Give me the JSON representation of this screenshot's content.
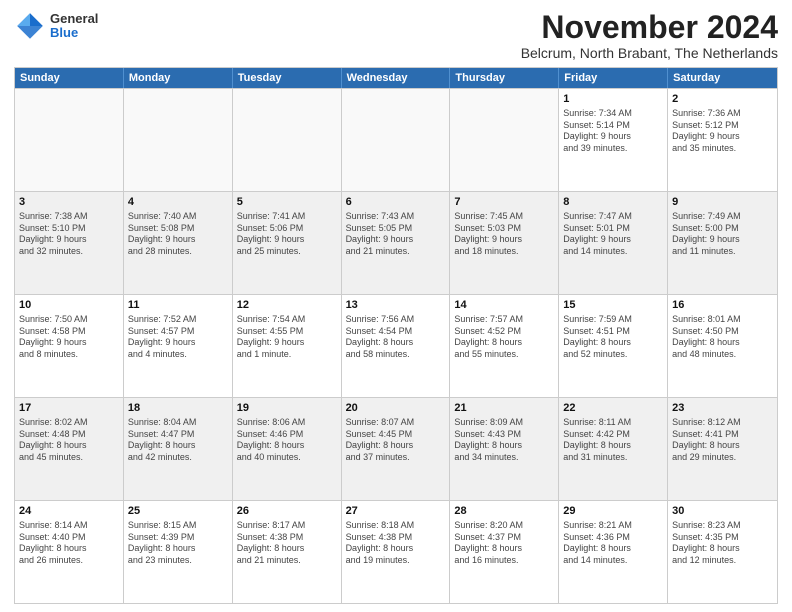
{
  "logo": {
    "general": "General",
    "blue": "Blue"
  },
  "title": "November 2024",
  "location": "Belcrum, North Brabant, The Netherlands",
  "days_of_week": [
    "Sunday",
    "Monday",
    "Tuesday",
    "Wednesday",
    "Thursday",
    "Friday",
    "Saturday"
  ],
  "weeks": [
    [
      {
        "day": "",
        "info": ""
      },
      {
        "day": "",
        "info": ""
      },
      {
        "day": "",
        "info": ""
      },
      {
        "day": "",
        "info": ""
      },
      {
        "day": "",
        "info": ""
      },
      {
        "day": "1",
        "info": "Sunrise: 7:34 AM\nSunset: 5:14 PM\nDaylight: 9 hours\nand 39 minutes."
      },
      {
        "day": "2",
        "info": "Sunrise: 7:36 AM\nSunset: 5:12 PM\nDaylight: 9 hours\nand 35 minutes."
      }
    ],
    [
      {
        "day": "3",
        "info": "Sunrise: 7:38 AM\nSunset: 5:10 PM\nDaylight: 9 hours\nand 32 minutes."
      },
      {
        "day": "4",
        "info": "Sunrise: 7:40 AM\nSunset: 5:08 PM\nDaylight: 9 hours\nand 28 minutes."
      },
      {
        "day": "5",
        "info": "Sunrise: 7:41 AM\nSunset: 5:06 PM\nDaylight: 9 hours\nand 25 minutes."
      },
      {
        "day": "6",
        "info": "Sunrise: 7:43 AM\nSunset: 5:05 PM\nDaylight: 9 hours\nand 21 minutes."
      },
      {
        "day": "7",
        "info": "Sunrise: 7:45 AM\nSunset: 5:03 PM\nDaylight: 9 hours\nand 18 minutes."
      },
      {
        "day": "8",
        "info": "Sunrise: 7:47 AM\nSunset: 5:01 PM\nDaylight: 9 hours\nand 14 minutes."
      },
      {
        "day": "9",
        "info": "Sunrise: 7:49 AM\nSunset: 5:00 PM\nDaylight: 9 hours\nand 11 minutes."
      }
    ],
    [
      {
        "day": "10",
        "info": "Sunrise: 7:50 AM\nSunset: 4:58 PM\nDaylight: 9 hours\nand 8 minutes."
      },
      {
        "day": "11",
        "info": "Sunrise: 7:52 AM\nSunset: 4:57 PM\nDaylight: 9 hours\nand 4 minutes."
      },
      {
        "day": "12",
        "info": "Sunrise: 7:54 AM\nSunset: 4:55 PM\nDaylight: 9 hours\nand 1 minute."
      },
      {
        "day": "13",
        "info": "Sunrise: 7:56 AM\nSunset: 4:54 PM\nDaylight: 8 hours\nand 58 minutes."
      },
      {
        "day": "14",
        "info": "Sunrise: 7:57 AM\nSunset: 4:52 PM\nDaylight: 8 hours\nand 55 minutes."
      },
      {
        "day": "15",
        "info": "Sunrise: 7:59 AM\nSunset: 4:51 PM\nDaylight: 8 hours\nand 52 minutes."
      },
      {
        "day": "16",
        "info": "Sunrise: 8:01 AM\nSunset: 4:50 PM\nDaylight: 8 hours\nand 48 minutes."
      }
    ],
    [
      {
        "day": "17",
        "info": "Sunrise: 8:02 AM\nSunset: 4:48 PM\nDaylight: 8 hours\nand 45 minutes."
      },
      {
        "day": "18",
        "info": "Sunrise: 8:04 AM\nSunset: 4:47 PM\nDaylight: 8 hours\nand 42 minutes."
      },
      {
        "day": "19",
        "info": "Sunrise: 8:06 AM\nSunset: 4:46 PM\nDaylight: 8 hours\nand 40 minutes."
      },
      {
        "day": "20",
        "info": "Sunrise: 8:07 AM\nSunset: 4:45 PM\nDaylight: 8 hours\nand 37 minutes."
      },
      {
        "day": "21",
        "info": "Sunrise: 8:09 AM\nSunset: 4:43 PM\nDaylight: 8 hours\nand 34 minutes."
      },
      {
        "day": "22",
        "info": "Sunrise: 8:11 AM\nSunset: 4:42 PM\nDaylight: 8 hours\nand 31 minutes."
      },
      {
        "day": "23",
        "info": "Sunrise: 8:12 AM\nSunset: 4:41 PM\nDaylight: 8 hours\nand 29 minutes."
      }
    ],
    [
      {
        "day": "24",
        "info": "Sunrise: 8:14 AM\nSunset: 4:40 PM\nDaylight: 8 hours\nand 26 minutes."
      },
      {
        "day": "25",
        "info": "Sunrise: 8:15 AM\nSunset: 4:39 PM\nDaylight: 8 hours\nand 23 minutes."
      },
      {
        "day": "26",
        "info": "Sunrise: 8:17 AM\nSunset: 4:38 PM\nDaylight: 8 hours\nand 21 minutes."
      },
      {
        "day": "27",
        "info": "Sunrise: 8:18 AM\nSunset: 4:38 PM\nDaylight: 8 hours\nand 19 minutes."
      },
      {
        "day": "28",
        "info": "Sunrise: 8:20 AM\nSunset: 4:37 PM\nDaylight: 8 hours\nand 16 minutes."
      },
      {
        "day": "29",
        "info": "Sunrise: 8:21 AM\nSunset: 4:36 PM\nDaylight: 8 hours\nand 14 minutes."
      },
      {
        "day": "30",
        "info": "Sunrise: 8:23 AM\nSunset: 4:35 PM\nDaylight: 8 hours\nand 12 minutes."
      }
    ]
  ]
}
